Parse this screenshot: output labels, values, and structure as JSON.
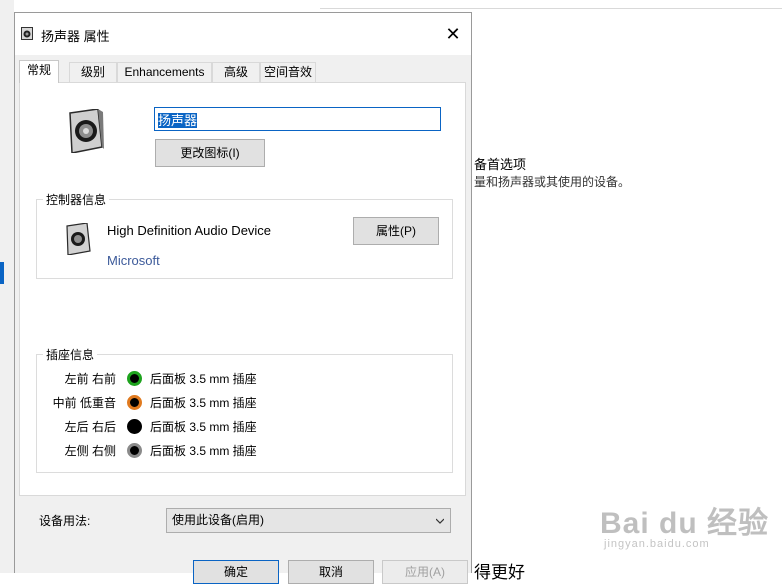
{
  "background": {
    "heading": "备首选项",
    "description": "量和扬声器或其使用的设备。",
    "bottom_partial_text": "得更好"
  },
  "watermark": {
    "main": "Bai du 经验",
    "sub": "jingyan.baidu.com"
  },
  "dialog": {
    "title": "扬声器 属性",
    "close_glyph": "✕",
    "tabs": [
      {
        "label": "常规",
        "active": true
      },
      {
        "label": "级别",
        "active": false
      },
      {
        "label": "Enhancements",
        "active": false
      },
      {
        "label": "高级",
        "active": false
      },
      {
        "label": "空间音效",
        "active": false
      }
    ],
    "device_name": "扬声器",
    "change_icon_button": "更改图标(I)",
    "controller": {
      "group_label": "控制器信息",
      "name": "High Definition Audio Device",
      "vendor": "Microsoft",
      "properties_button": "属性(P)"
    },
    "jacks": {
      "group_label": "插座信息",
      "rows": [
        {
          "label": "左前 右前",
          "color": "#1ea31e",
          "text": "后面板 3.5 mm 插座"
        },
        {
          "label": "中前 低重音",
          "color": "#e07a1f",
          "text": "后面板 3.5 mm 插座"
        },
        {
          "label": "左后 右后",
          "color": "#000000",
          "text": "后面板 3.5 mm 插座"
        },
        {
          "label": "左侧 右侧",
          "color": "#8a8a8a",
          "text": "后面板 3.5 mm 插座"
        }
      ]
    },
    "usage": {
      "label": "设备用法:",
      "selected": "使用此设备(启用)"
    },
    "buttons": {
      "ok": "确定",
      "cancel": "取消",
      "apply": "应用(A)"
    }
  },
  "colors": {
    "accent": "#0a64c4",
    "dialog_bg": "#f0f0f0"
  }
}
